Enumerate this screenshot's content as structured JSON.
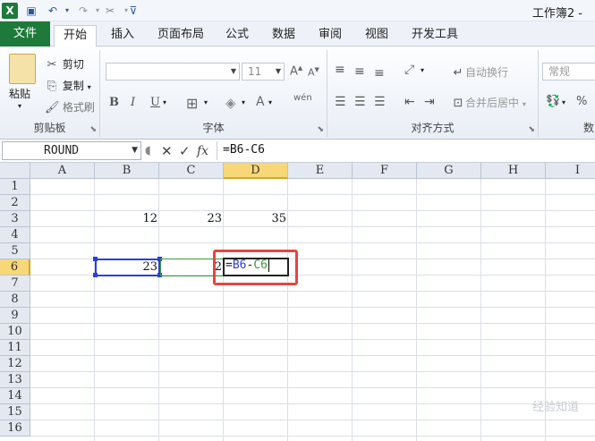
{
  "app": {
    "title": "工作簿2 -",
    "quick_access": [
      {
        "name": "excel-logo-icon",
        "glyph": "X"
      },
      {
        "name": "save-icon",
        "glyph": "▣"
      },
      {
        "name": "undo-icon",
        "glyph": "↶"
      },
      {
        "name": "redo-icon",
        "glyph": "↷"
      },
      {
        "name": "tools-icon",
        "glyph": "✂"
      },
      {
        "name": "customize-icon",
        "glyph": "⊽"
      }
    ]
  },
  "tabs": [
    "文件",
    "开始",
    "插入",
    "页面布局",
    "公式",
    "数据",
    "审阅",
    "视图",
    "开发工具"
  ],
  "active_tab": "开始",
  "ribbon": {
    "clipboard": {
      "paste": "粘贴",
      "cut": "剪切",
      "copy": "复制",
      "format_painter": "格式刷",
      "label": "剪贴板"
    },
    "font": {
      "font_size": "11",
      "grow": "A",
      "shrink": "A",
      "bold": "B",
      "italic": "I",
      "underline": "U",
      "font_color": "A",
      "phonetic": "wén",
      "label": "字体"
    },
    "alignment": {
      "wrap_text": "自动换行",
      "merge_center": "合并后居中",
      "label": "对齐方式"
    },
    "number": {
      "format": "常规",
      "percent": "%",
      "label": "数"
    }
  },
  "formula_bar": {
    "name_box": "ROUND",
    "cancel": "✕",
    "enter": "✓",
    "function": "fx",
    "formula": "=B6-C6"
  },
  "columns": [
    "A",
    "B",
    "C",
    "D",
    "E",
    "F",
    "G",
    "H",
    "I"
  ],
  "selected_column": "D",
  "rows": [
    "1",
    "2",
    "3",
    "4",
    "5",
    "6",
    "7",
    "8",
    "9",
    "10",
    "11",
    "12",
    "13",
    "14",
    "15",
    "16"
  ],
  "selected_row": "6",
  "cells": {
    "B3": "12",
    "C3": "23",
    "D3": "35",
    "B6": "23",
    "C6": "2"
  },
  "editing": {
    "cell": "D6",
    "prefix": "=",
    "ref1": "B6",
    "op": "-",
    "ref2": "C6"
  },
  "colors": {
    "file_tab": "#1e7a3a",
    "ref1": "#2c3fd6",
    "ref2": "#3a9a3a",
    "highlight": "#e64545",
    "selected_header": "#f7d777"
  },
  "watermark": "经验知道"
}
